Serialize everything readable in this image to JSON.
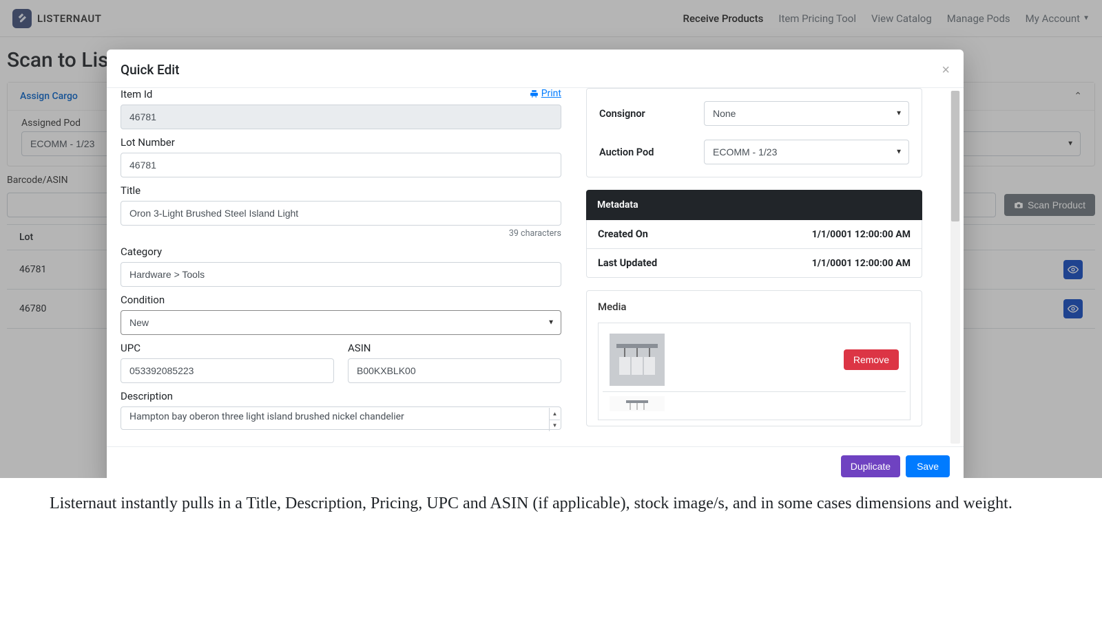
{
  "brand": "LISTERNAUT",
  "nav": {
    "receive": "Receive Products",
    "pricing": "Item Pricing Tool",
    "catalog": "View Catalog",
    "pods": "Manage Pods",
    "account": "My Account"
  },
  "page": {
    "title": "Scan to List",
    "assign_cargo": "Assign Cargo",
    "assigned_pod_label": "Assigned Pod",
    "assigned_pod_value": "ECOMM - 1/23",
    "barcode_label": "Barcode/ASIN",
    "scan_btn": "Scan Product",
    "lot_header": "Lot",
    "rows": [
      "46781",
      "46780"
    ]
  },
  "modal": {
    "title": "Quick Edit",
    "print": "Print",
    "item_id_label": "Item Id",
    "item_id": "46781",
    "lot_label": "Lot Number",
    "lot": "46781",
    "title_label": "Title",
    "title_value": "Oron 3-Light Brushed Steel Island Light",
    "title_chars": "39 characters",
    "category_label": "Category",
    "category": "Hardware > Tools",
    "condition_label": "Condition",
    "condition": "New",
    "upc_label": "UPC",
    "upc": "053392085223",
    "asin_label": "ASIN",
    "asin": "B00KXBLK00",
    "desc_label": "Description",
    "desc": "Hampton bay oberon three light island brushed nickel chandelier",
    "consignor_label": "Consignor",
    "consignor": "None",
    "auction_pod_label": "Auction Pod",
    "auction_pod": "ECOMM - 1/23",
    "metadata_label": "Metadata",
    "created_label": "Created On",
    "created_val": "1/1/0001 12:00:00 AM",
    "updated_label": "Last Updated",
    "updated_val": "1/1/0001 12:00:00 AM",
    "media_label": "Media",
    "remove": "Remove",
    "duplicate": "Duplicate",
    "save": "Save"
  },
  "caption": "Listernaut instantly pulls in a Title, Description, Pricing, UPC and ASIN (if applicable), stock image/s, and in some cases dimensions and weight."
}
